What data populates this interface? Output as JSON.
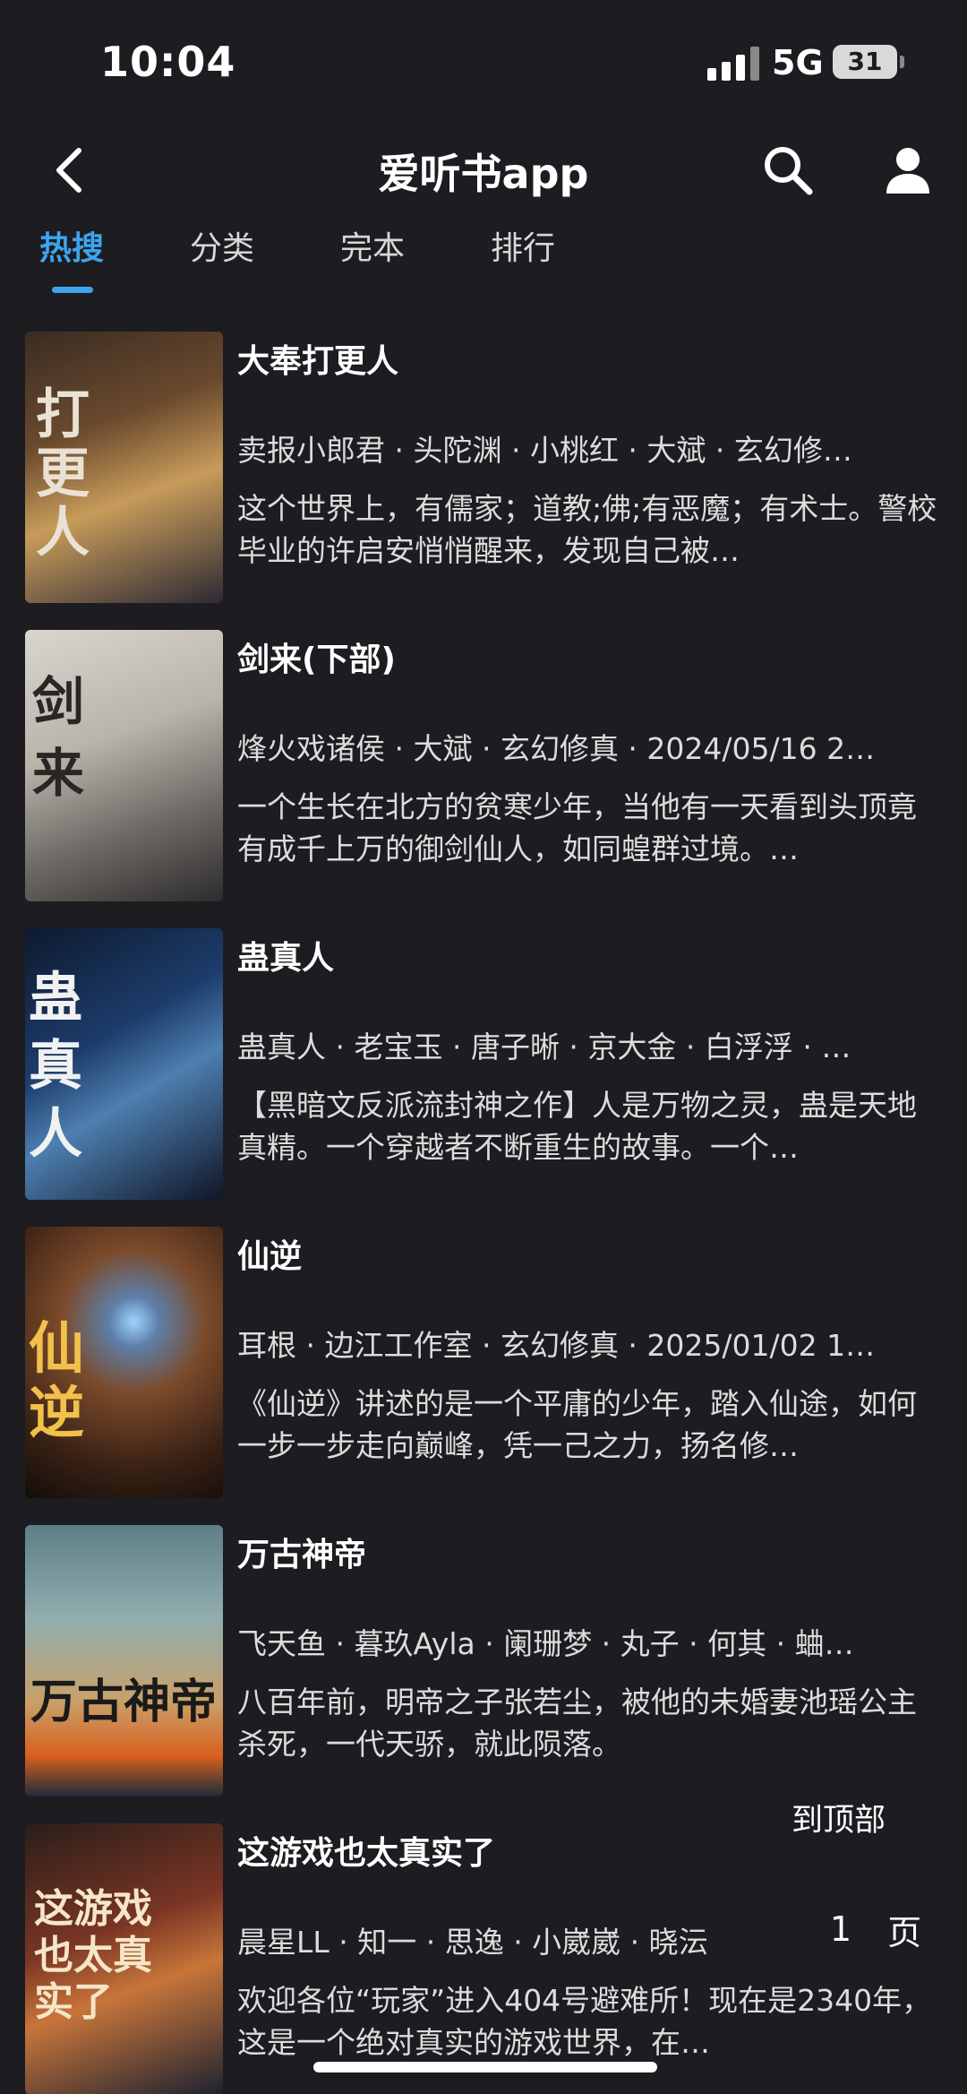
{
  "status": {
    "time": "10:04",
    "network": "5G",
    "battery": "31"
  },
  "nav": {
    "title": "爱听书app",
    "back_icon": "chevron-left-icon",
    "search_icon": "search-icon",
    "user_icon": "user-icon"
  },
  "tabs": [
    {
      "label": "热搜",
      "active": true
    },
    {
      "label": "分类",
      "active": false
    },
    {
      "label": "完本",
      "active": false
    },
    {
      "label": "排行",
      "active": false
    }
  ],
  "books": [
    {
      "title": "大奉打更人",
      "meta": "卖报小郎君 · 头陀渊 · 小桃红 · 大斌 · 玄幻修…",
      "desc": "这个世界上，有儒家；道教;佛;有恶魔；有术士。警校毕业的许启安悄悄醒来，发现自己被…",
      "cover_text": "打更人"
    },
    {
      "title": "剑来(下部)",
      "meta": "烽火戏诸侯 · 大斌 · 玄幻修真 · 2024/05/16 2…",
      "desc": "一个生长在北方的贫寒少年，当他有一天看到头顶竟有成千上万的御剑仙人，如同蝗群过境。…",
      "cover_text": "剑来"
    },
    {
      "title": "蛊真人",
      "meta": "蛊真人 · 老宝玉 · 唐子晰 · 京大金 · 白浮浮 · …",
      "desc": "【黑暗文反派流封神之作】人是万物之灵，蛊是天地真精。一个穿越者不断重生的故事。一个…",
      "cover_text": "蛊真人"
    },
    {
      "title": "仙逆",
      "meta": "耳根 · 边江工作室 · 玄幻修真 · 2025/01/02 1…",
      "desc": "《仙逆》讲述的是一个平庸的少年，踏入仙途，如何一步一步走向巅峰，凭一己之力，扬名修…",
      "cover_text": "仙逆"
    },
    {
      "title": "万古神帝",
      "meta": "飞天鱼 · 暮玖Ayla · 阑珊梦 · 丸子 · 何其 · 蛐…",
      "desc": "八百年前，明帝之子张若尘，被他的未婚妻池瑶公主杀死，一代天骄，就此陨落。",
      "cover_text": "万古神帝"
    },
    {
      "title": "这游戏也太真实了",
      "meta": "晨星LL · 知一 · 思逸 · 小崴崴 · 晓沄",
      "desc": "欢迎各位“玩家”进入404号避难所！现在是2340年，这是一个绝对真实的游戏世界，在…",
      "cover_text": "这游戏也太真实了"
    }
  ],
  "float": {
    "to_top": "到顶部",
    "page_num": "1",
    "page_unit": "页"
  },
  "colors": {
    "background": "#1c1c21",
    "accent": "#3ea4ee",
    "text": "#dcdcdc"
  }
}
